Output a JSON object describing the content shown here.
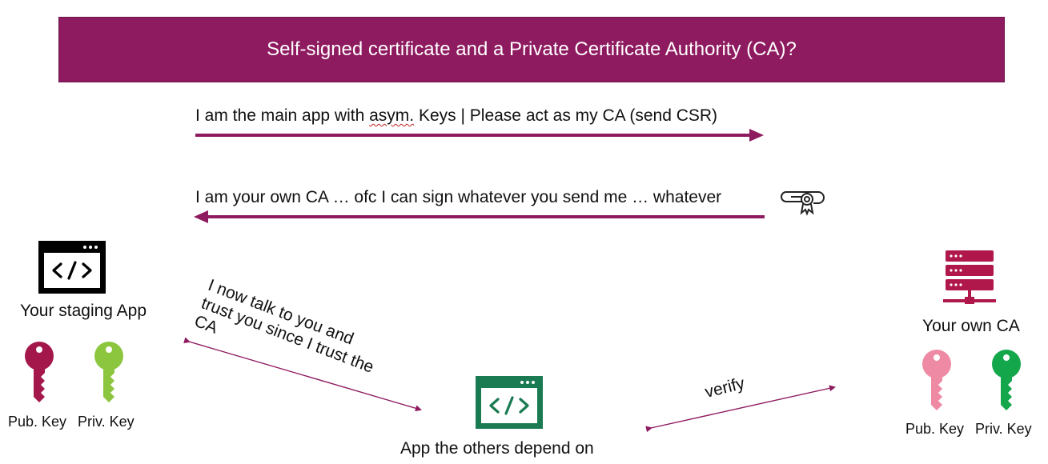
{
  "title": "Self-signed certificate and a Private Certificate Authority (CA)?",
  "messages": {
    "request_prefix": "I am the main app with ",
    "request_typo": "asym.",
    "request_suffix": " Keys | Please act as my CA (send CSR)",
    "response": "I am your own CA … ofc I can sign whatever you send me … whatever"
  },
  "nodes": {
    "staging_app": {
      "label": "Your staging App",
      "icon": "code-window-icon",
      "color": "#000000",
      "keys": {
        "public": "Pub. Key",
        "private": "Priv. Key"
      }
    },
    "dependent_app": {
      "label": "App the others depend on",
      "icon": "code-window-icon",
      "color": "#1a7a52"
    },
    "own_ca": {
      "label": "Your own CA",
      "icon": "server-icon",
      "color": "#b0174a",
      "keys": {
        "public": "Pub. Key",
        "private": "Priv. Key"
      }
    }
  },
  "edges": {
    "trust_label_lines": [
      "I now talk to you and",
      "trust you since I trust the",
      "CA"
    ],
    "verify_label": "verify"
  },
  "colors": {
    "banner": "#8e1a5f",
    "arrow": "#8e1a5f",
    "staging_pub_key": "#a3174a",
    "staging_priv_key": "#8cc63f",
    "ca_pub_key": "#ee8aa3",
    "ca_priv_key": "#13a64a"
  }
}
